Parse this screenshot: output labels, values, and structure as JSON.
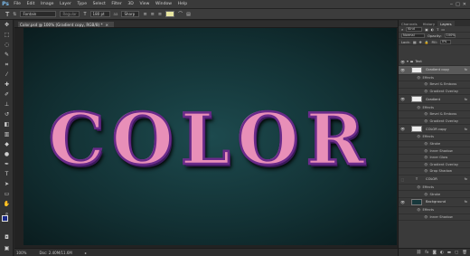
{
  "menu": [
    "File",
    "Edit",
    "Image",
    "Layer",
    "Type",
    "Select",
    "Filter",
    "3D",
    "View",
    "Window",
    "Help"
  ],
  "options": {
    "font_family": "Fontain",
    "font_style": "Regular",
    "font_size": "180 pt",
    "aa": "aa",
    "aa_mode": "Sharp"
  },
  "document": {
    "tab_title": "Color.psd @ 100% (Gradient copy, RGB/8) *"
  },
  "canvas": {
    "text": "COLOR"
  },
  "status": {
    "zoom": "100%",
    "doc_size": "Doc: 2.40M/11.6M"
  },
  "panel": {
    "tabs": [
      "Channels",
      "History",
      "Layers"
    ],
    "filter_label": "Kind",
    "blend_mode": "Normal",
    "opacity_label": "Opacity:",
    "opacity": "100%",
    "lock_label": "Lock:",
    "fill_label": "Fill:",
    "fill": "0%"
  },
  "layers": {
    "group_name": "Text",
    "gradient_copy": "Gradient copy",
    "effects": "Effects",
    "bevel": "Bevel & Emboss",
    "gradient_overlay": "Gradient Overlay",
    "gradient": "Gradient",
    "color_copy": "COLOR copy",
    "stroke": "Stroke",
    "inner_shadow": "Inner Shadow",
    "inner_glow": "Inner Glow",
    "drop_shadow": "Drop Shadow",
    "color": "COLOR",
    "background": "Background",
    "fx": "fx"
  },
  "colors": {
    "canvas_bg": "#163d41",
    "text_fill": "#e88fb8",
    "text_outline": "#6a2a8a",
    "foreground": "#1a2a8a"
  }
}
